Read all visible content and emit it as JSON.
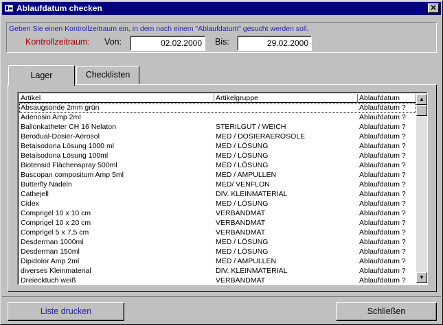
{
  "window": {
    "title": "Ablaufdatum checken",
    "close_glyph": "✕"
  },
  "filter": {
    "hint": "Geben Sie einen Kontrollzeitraum ein, in dem nach einem \"Ablaufdatum\" gesucht werden soll.",
    "label": "Kontrollzeitraum:",
    "von_label": "Von:",
    "von_value": "02.02.2000",
    "bis_label": "Bis:",
    "bis_value": "29.02.2000"
  },
  "tabs": [
    {
      "label": "Lager",
      "active": true
    },
    {
      "label": "Checklisten",
      "active": false
    }
  ],
  "list": {
    "headers": [
      "Artikel",
      "Artikelgruppe",
      "Ablaufdatum"
    ],
    "rows": [
      [
        "Absaugsonde 2mm grün",
        "",
        "Ablaufdatum ?"
      ],
      [
        "Adenosin Amp 2ml",
        "",
        "Ablaufdatum ?"
      ],
      [
        "Ballonkatheter CH 16 Nelaton",
        "STERILGUT / WEICH",
        "Ablaufdatum ?"
      ],
      [
        "Berodual-Dosier-Aerosol",
        "MED / DOSIERAEROSOLE",
        "Ablaufdatum ?"
      ],
      [
        "Betaisodona Lösung 1000 ml",
        "MED / LÖSUNG",
        "Ablaufdatum ?"
      ],
      [
        "Betaisodona Lösung 100ml",
        "MED / LÖSUNG",
        "Ablaufdatum ?"
      ],
      [
        "Biotensid Flächenspray 500ml",
        "MED / LÖSUNG",
        "Ablaufdatum ?"
      ],
      [
        "Buscopan compositum Amp 5ml",
        "MED / AMPULLEN",
        "Ablaufdatum ?"
      ],
      [
        "Butterfly Nadeln",
        "MED/ VENFLON",
        "Ablaufdatum ?"
      ],
      [
        "Cathejell",
        "DIV. KLEINMATERIAL",
        "Ablaufdatum ?"
      ],
      [
        "Cidex",
        "MED / LÖSUNG",
        "Ablaufdatum ?"
      ],
      [
        "Comprigel 10 x 10 cm",
        "VERBANDMAT",
        "Ablaufdatum ?"
      ],
      [
        "Comprigel 10 x 20 cm",
        "VERBANDMAT",
        "Ablaufdatum ?"
      ],
      [
        "Comprigel 5 x 7,5 cm",
        "VERBANDMAT",
        "Ablaufdatum ?"
      ],
      [
        "Desderman 1000ml",
        "MED / LÖSUNG",
        "Ablaufdatum ?"
      ],
      [
        "Desderman 150ml",
        "MED / LÖSUNG",
        "Ablaufdatum ?"
      ],
      [
        "Dipidolor Amp 2ml",
        "MED / AMPULLEN",
        "Ablaufdatum ?"
      ],
      [
        "diverses Kleinmaterial",
        "DIV. KLEINMATERIAL",
        "Ablaufdatum ?"
      ],
      [
        "Dreiecktuch weiß",
        "VERBANDMAT",
        "Ablaufdatum ?"
      ]
    ],
    "scroll_up_glyph": "▲",
    "scroll_down_glyph": "▼"
  },
  "buttons": {
    "print_label": "Liste drucken",
    "close_label": "Schließen"
  }
}
